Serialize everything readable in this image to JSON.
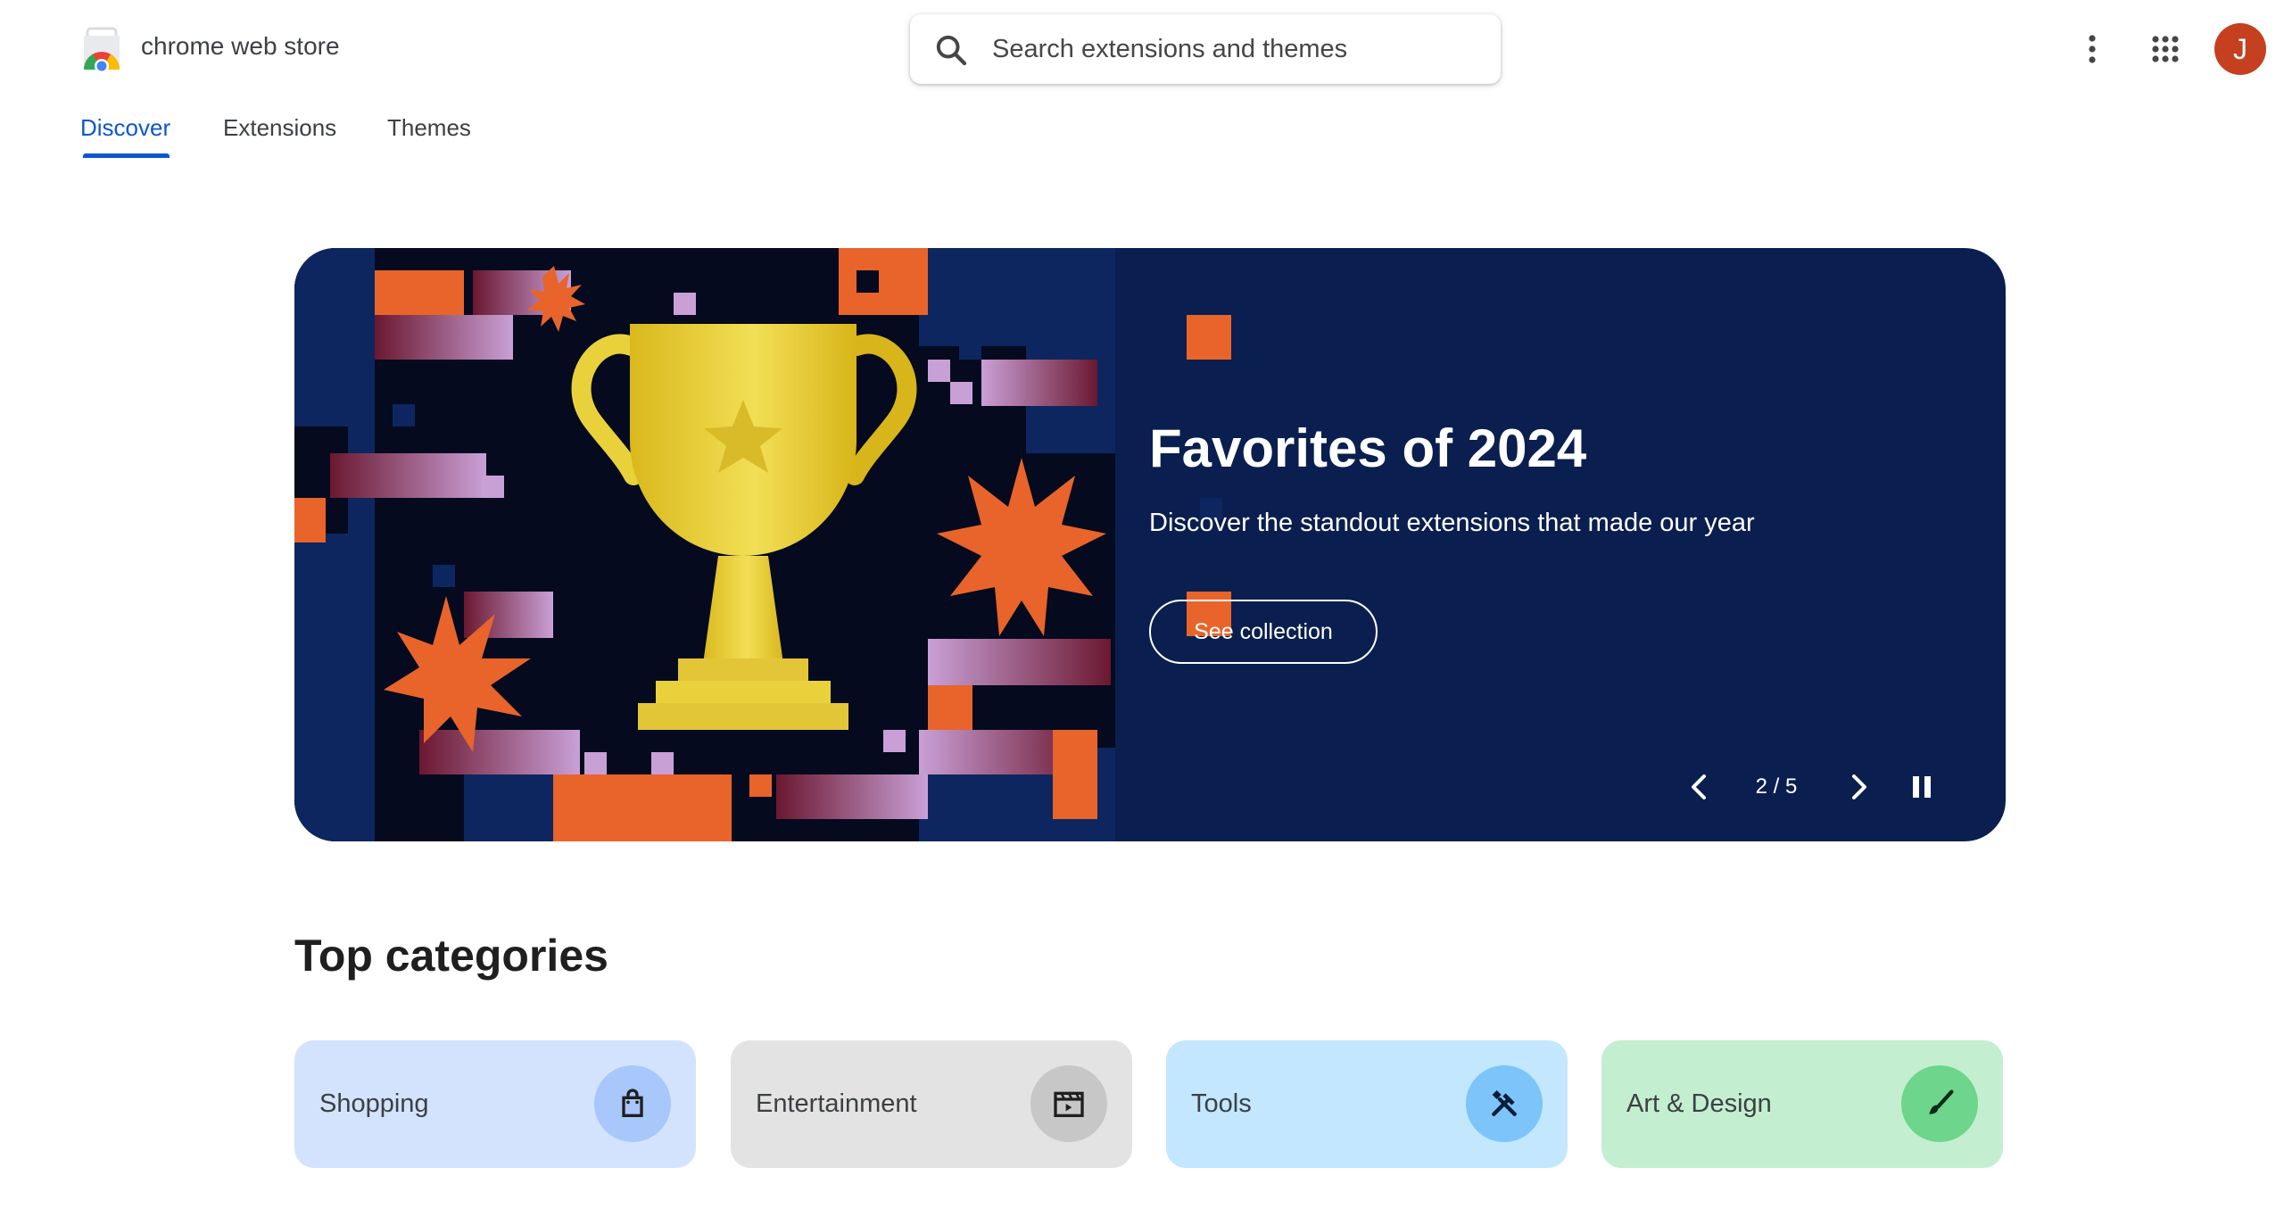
{
  "header": {
    "brand": "chrome web store",
    "search_placeholder": "Search extensions and themes",
    "avatar_letter": "J"
  },
  "tabs": [
    {
      "label": "Discover",
      "active": true
    },
    {
      "label": "Extensions",
      "active": false
    },
    {
      "label": "Themes",
      "active": false
    }
  ],
  "banner": {
    "title": "Favorites of 2024",
    "subtitle": "Discover the standout extensions that made our year",
    "cta": "See collection",
    "counter": "2 / 5",
    "background_color": "#0a1f4f",
    "accent_orange": "#e8642b"
  },
  "categories": {
    "title": "Top categories",
    "items": [
      {
        "label": "Shopping",
        "icon": "shopping-bag-icon",
        "bg": "#d3e3fd",
        "icon_bg": "#a8c7fa"
      },
      {
        "label": "Entertainment",
        "icon": "clapperboard-icon",
        "bg": "#e3e3e3",
        "icon_bg": "#c7c7c7"
      },
      {
        "label": "Tools",
        "icon": "tools-icon",
        "bg": "#c2e7ff",
        "icon_bg": "#7cc4fa"
      },
      {
        "label": "Art & Design",
        "icon": "paintbrush-icon",
        "bg": "#c4eed0",
        "icon_bg": "#6dd58c"
      }
    ]
  }
}
